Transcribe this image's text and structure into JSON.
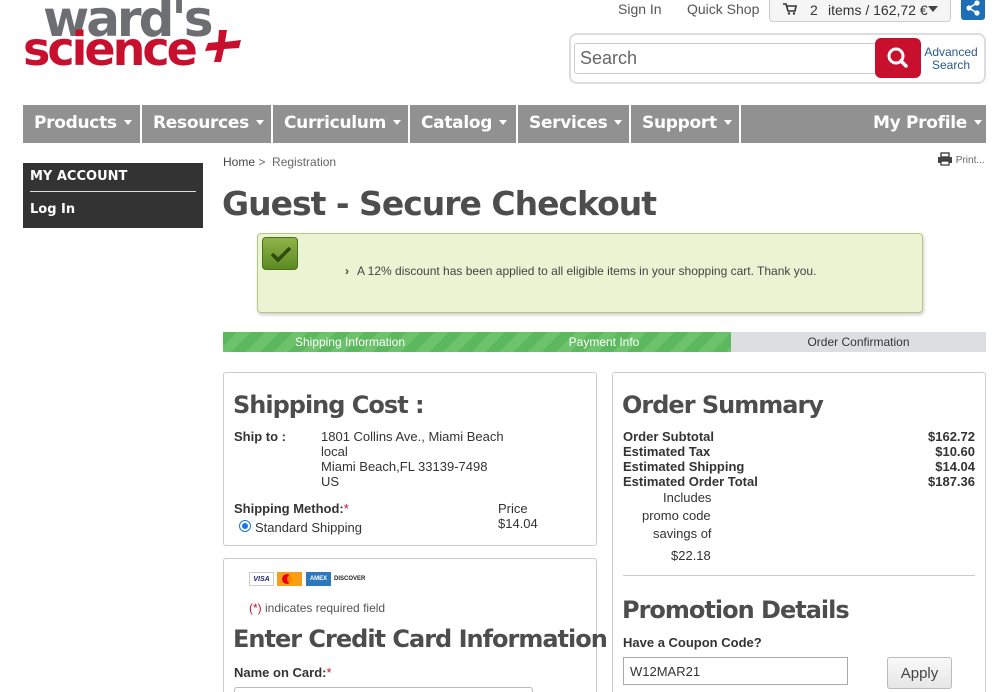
{
  "brand": {
    "line1": "ward's",
    "line2": "science"
  },
  "header": {
    "sign_in": "Sign In",
    "quick_shop": "Quick Shop",
    "cart_count": "2",
    "cart_text": "items / 162,72 €",
    "search_placeholder": "Search",
    "advanced_search": "Advanced Search"
  },
  "nav": {
    "items": [
      "Products",
      "Resources",
      "Curriculum",
      "Catalog",
      "Services",
      "Support"
    ],
    "profile": "My Profile"
  },
  "sidebar": {
    "heading": "MY ACCOUNT",
    "login": "Log In"
  },
  "breadcrumb": {
    "home": "Home",
    "sep": ">",
    "current": "Registration"
  },
  "print_label": "Print...",
  "page_title": "Guest - Secure Checkout",
  "notice": "A 12% discount has been applied to all eligible items in your shopping cart. Thank you.",
  "steps": [
    {
      "label": "Shipping Information",
      "status": "complete"
    },
    {
      "label": "Payment Info",
      "status": "complete"
    },
    {
      "label": "Order Confirmation",
      "status": "pending"
    }
  ],
  "shipping": {
    "title": "Shipping Cost :",
    "ship_to_label": "Ship to :",
    "address": [
      "1801 Collins Ave., Miami Beach",
      "local",
      "Miami Beach,FL 33139-7498",
      "US"
    ],
    "method_label": "Shipping Method:",
    "required_mark": "*",
    "price_label": "Price",
    "method": "Standard Shipping",
    "price": "$14.04"
  },
  "payment": {
    "card_brands": [
      "VISA",
      "MasterCard",
      "AMEX",
      "DISCOVER"
    ],
    "required_note_mark": "(*)",
    "required_note": " indicates required field",
    "title": "Enter Credit Card Information",
    "name_label": "Name on Card:",
    "name_value": ""
  },
  "order_summary": {
    "title": "Order Summary",
    "rows": [
      {
        "label": "Order Subtotal",
        "value": "$162.72"
      },
      {
        "label": "Estimated Tax",
        "value": "$10.60"
      },
      {
        "label": "Estimated Shipping",
        "value": "$14.04"
      },
      {
        "label": "Estimated Order Total",
        "value": "$187.36"
      }
    ],
    "promo_note": [
      "Includes",
      "promo code",
      "savings of",
      "$22.18"
    ]
  },
  "promotion": {
    "title": "Promotion Details",
    "coupon_label": "Have a Coupon Code?",
    "coupon_value": "W12MAR21",
    "apply": "Apply"
  },
  "colors": {
    "brand_red": "#c8102e",
    "nav_gray": "#919191",
    "progress_green": "#5cb85c",
    "notice_bg": "#eaf3d2"
  }
}
